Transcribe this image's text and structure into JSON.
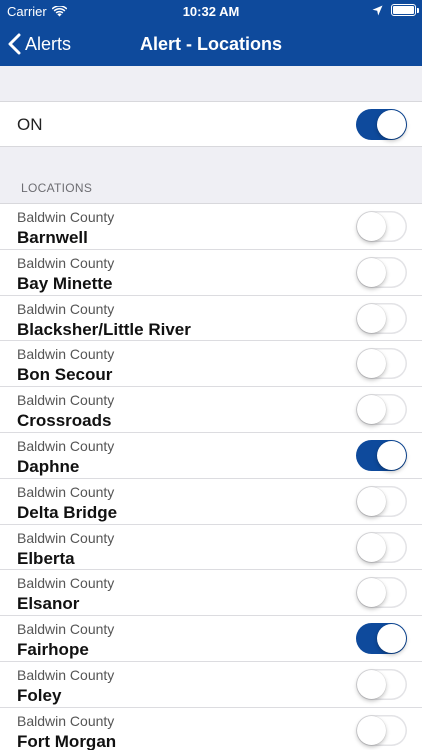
{
  "status_bar": {
    "carrier": "Carrier",
    "time": "10:32 AM"
  },
  "nav": {
    "back_label": "Alerts",
    "title": "Alert - Locations"
  },
  "master": {
    "label": "ON",
    "on": true
  },
  "section_header": "LOCATIONS",
  "colors": {
    "accent": "#0e4a9c",
    "background": "#efeff4"
  },
  "locations": [
    {
      "county": "Baldwin County",
      "name": "Barnwell",
      "on": false
    },
    {
      "county": "Baldwin County",
      "name": "Bay Minette",
      "on": false
    },
    {
      "county": "Baldwin County",
      "name": "Blacksher/Little River",
      "on": false
    },
    {
      "county": "Baldwin County",
      "name": "Bon Secour",
      "on": false
    },
    {
      "county": "Baldwin County",
      "name": "Crossroads",
      "on": false
    },
    {
      "county": "Baldwin County",
      "name": "Daphne",
      "on": true
    },
    {
      "county": "Baldwin County",
      "name": "Delta Bridge",
      "on": false
    },
    {
      "county": "Baldwin County",
      "name": "Elberta",
      "on": false
    },
    {
      "county": "Baldwin County",
      "name": "Elsanor",
      "on": false
    },
    {
      "county": "Baldwin County",
      "name": "Fairhope",
      "on": true
    },
    {
      "county": "Baldwin County",
      "name": "Foley",
      "on": false
    },
    {
      "county": "Baldwin County",
      "name": "Fort Morgan",
      "on": false
    }
  ]
}
